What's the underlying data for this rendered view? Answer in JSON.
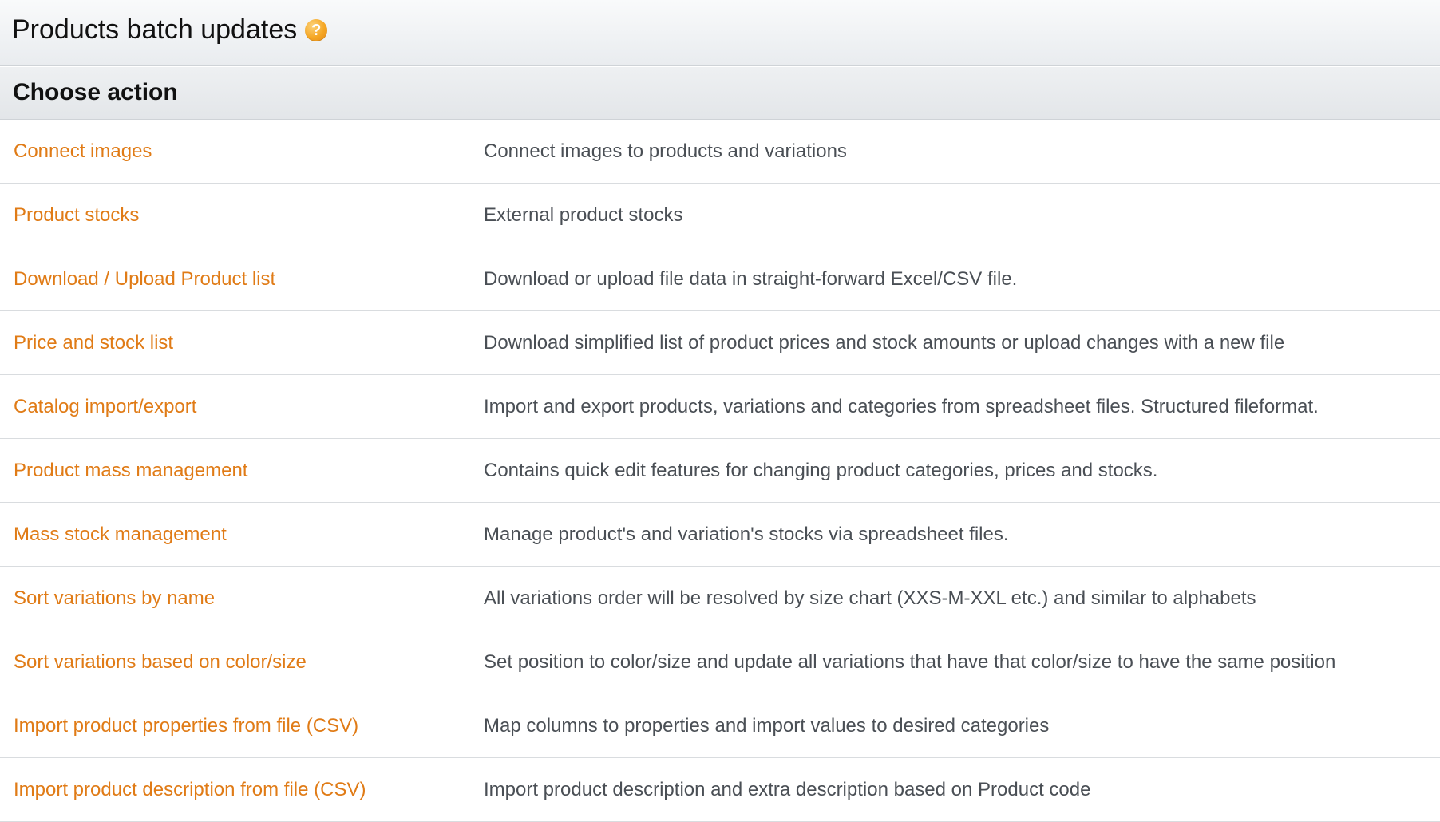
{
  "header": {
    "title": "Products batch updates",
    "help_icon": "question-mark-icon",
    "help_glyph": "?"
  },
  "section": {
    "title": "Choose action"
  },
  "colors": {
    "link": "#e07b16",
    "help_icon": "#f5a623"
  },
  "actions": [
    {
      "label": "Connect images",
      "description": "Connect images to products and variations"
    },
    {
      "label": "Product stocks",
      "description": "External product stocks"
    },
    {
      "label": "Download / Upload Product list",
      "description": "Download or upload file data in straight-forward Excel/CSV file."
    },
    {
      "label": "Price and stock list",
      "description": "Download simplified list of product prices and stock amounts or upload changes with a new file"
    },
    {
      "label": "Catalog import/export",
      "description": "Import and export products, variations and categories from spreadsheet files. Structured fileformat."
    },
    {
      "label": "Product mass management",
      "description": "Contains quick edit features for changing product categories, prices and stocks."
    },
    {
      "label": "Mass stock management",
      "description": "Manage product's and variation's stocks via spreadsheet files."
    },
    {
      "label": "Sort variations by name",
      "description": "All variations order will be resolved by size chart (XXS-M-XXL etc.) and similar to alphabets"
    },
    {
      "label": "Sort variations based on color/size",
      "description": "Set position to color/size and update all variations that have that color/size to have the same position"
    },
    {
      "label": "Import product properties from file (CSV)",
      "description": "Map columns to properties and import values to desired categories"
    },
    {
      "label": "Import product description from file (CSV)",
      "description": "Import product description and extra description based on Product code"
    }
  ]
}
